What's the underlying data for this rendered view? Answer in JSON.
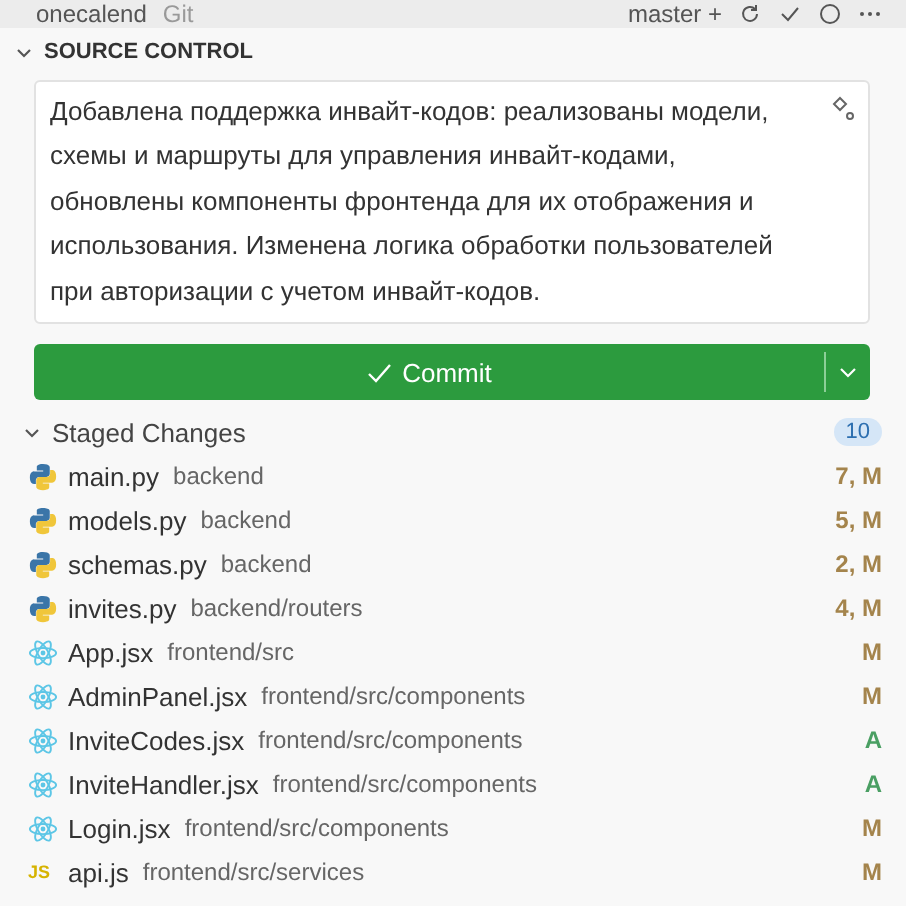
{
  "top_bar": {
    "repo": "onecalend",
    "provider": "Git",
    "branch": "master +"
  },
  "panel": {
    "title": "SOURCE CONTROL",
    "expanded": true
  },
  "message": {
    "value": "Добавлена поддержка инвайт-кодов: реализованы модели, схемы и маршруты для управления инвайт-кодами, обновлены компоненты фронтенда для их отображения и использования. Изменена логика обработки пользователей при авторизации с учетом инвайт-кодов."
  },
  "commit_button": {
    "label": "Commit"
  },
  "staged": {
    "title": "Staged Changes",
    "count": "10",
    "expanded": true,
    "files": [
      {
        "kind": "python",
        "name": "main.py",
        "path": "backend",
        "status": "7, M",
        "color": "#a4844c"
      },
      {
        "kind": "python",
        "name": "models.py",
        "path": "backend",
        "status": "5, M",
        "color": "#a4844c"
      },
      {
        "kind": "python",
        "name": "schemas.py",
        "path": "backend",
        "status": "2, M",
        "color": "#a4844c"
      },
      {
        "kind": "python",
        "name": "invites.py",
        "path": "backend/routers",
        "status": "4, M",
        "color": "#a4844c"
      },
      {
        "kind": "react",
        "name": "App.jsx",
        "path": "frontend/src",
        "status": "M",
        "color": "#a4844c"
      },
      {
        "kind": "react",
        "name": "AdminPanel.jsx",
        "path": "frontend/src/components",
        "status": "M",
        "color": "#a4844c"
      },
      {
        "kind": "react",
        "name": "InviteCodes.jsx",
        "path": "frontend/src/components",
        "status": "A",
        "color": "#4a9f63"
      },
      {
        "kind": "react",
        "name": "InviteHandler.jsx",
        "path": "frontend/src/components",
        "status": "A",
        "color": "#4a9f63"
      },
      {
        "kind": "react",
        "name": "Login.jsx",
        "path": "frontend/src/components",
        "status": "M",
        "color": "#a4844c"
      },
      {
        "kind": "js",
        "icon_text": "JS",
        "name": "api.js",
        "path": "frontend/src/services",
        "status": "M",
        "color": "#a4844c"
      }
    ]
  }
}
